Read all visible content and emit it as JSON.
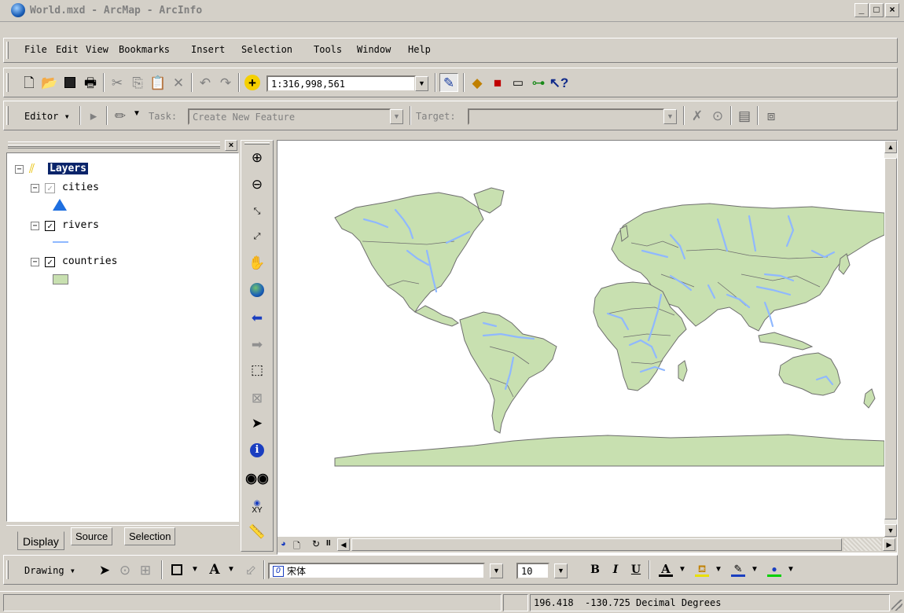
{
  "window": {
    "title": "World.mxd - ArcMap - ArcInfo",
    "min": "_",
    "max": "□",
    "close": "×"
  },
  "menu": [
    "File",
    "Edit",
    "View",
    "Bookmarks",
    "Insert",
    "Selection",
    "Tools",
    "Window",
    "Help"
  ],
  "standard_toolbar": {
    "scale": "1:316,998,561"
  },
  "editor_toolbar": {
    "editor_label": "Editor",
    "task_label": "Task:",
    "task_value": "Create New Feature",
    "target_label": "Target:",
    "target_value": ""
  },
  "toc": {
    "root": "Layers",
    "layers": [
      {
        "name": "cities",
        "checked": false,
        "symbol": "triangle",
        "color": "#1e6fe0"
      },
      {
        "name": "rivers",
        "checked": true,
        "symbol": "line",
        "color": "#8fb8ff"
      },
      {
        "name": "countries",
        "checked": true,
        "symbol": "fill",
        "color": "#c8e0b0"
      }
    ],
    "tabs": [
      "Display",
      "Source",
      "Selection"
    ]
  },
  "tools_toolbar": [
    "zoom-in",
    "zoom-out",
    "fixed-zoom-in",
    "fixed-zoom-out",
    "pan",
    "full-extent",
    "back",
    "forward",
    "select-features",
    "clear-selection",
    "select-elements",
    "identify",
    "find",
    "go-to-xy",
    "measure"
  ],
  "map": {
    "ocean_color": "#ffffff",
    "land_color": "#c8e0b0",
    "river_color": "#8fb8ff",
    "border_color": "#6e6e6e"
  },
  "drawing_toolbar": {
    "drawing_label": "Drawing",
    "font_name": "宋体",
    "font_size": "10",
    "bold": "B",
    "italic": "I",
    "underline": "U"
  },
  "status": {
    "coords": "196.418  -130.725 Decimal Degrees"
  }
}
